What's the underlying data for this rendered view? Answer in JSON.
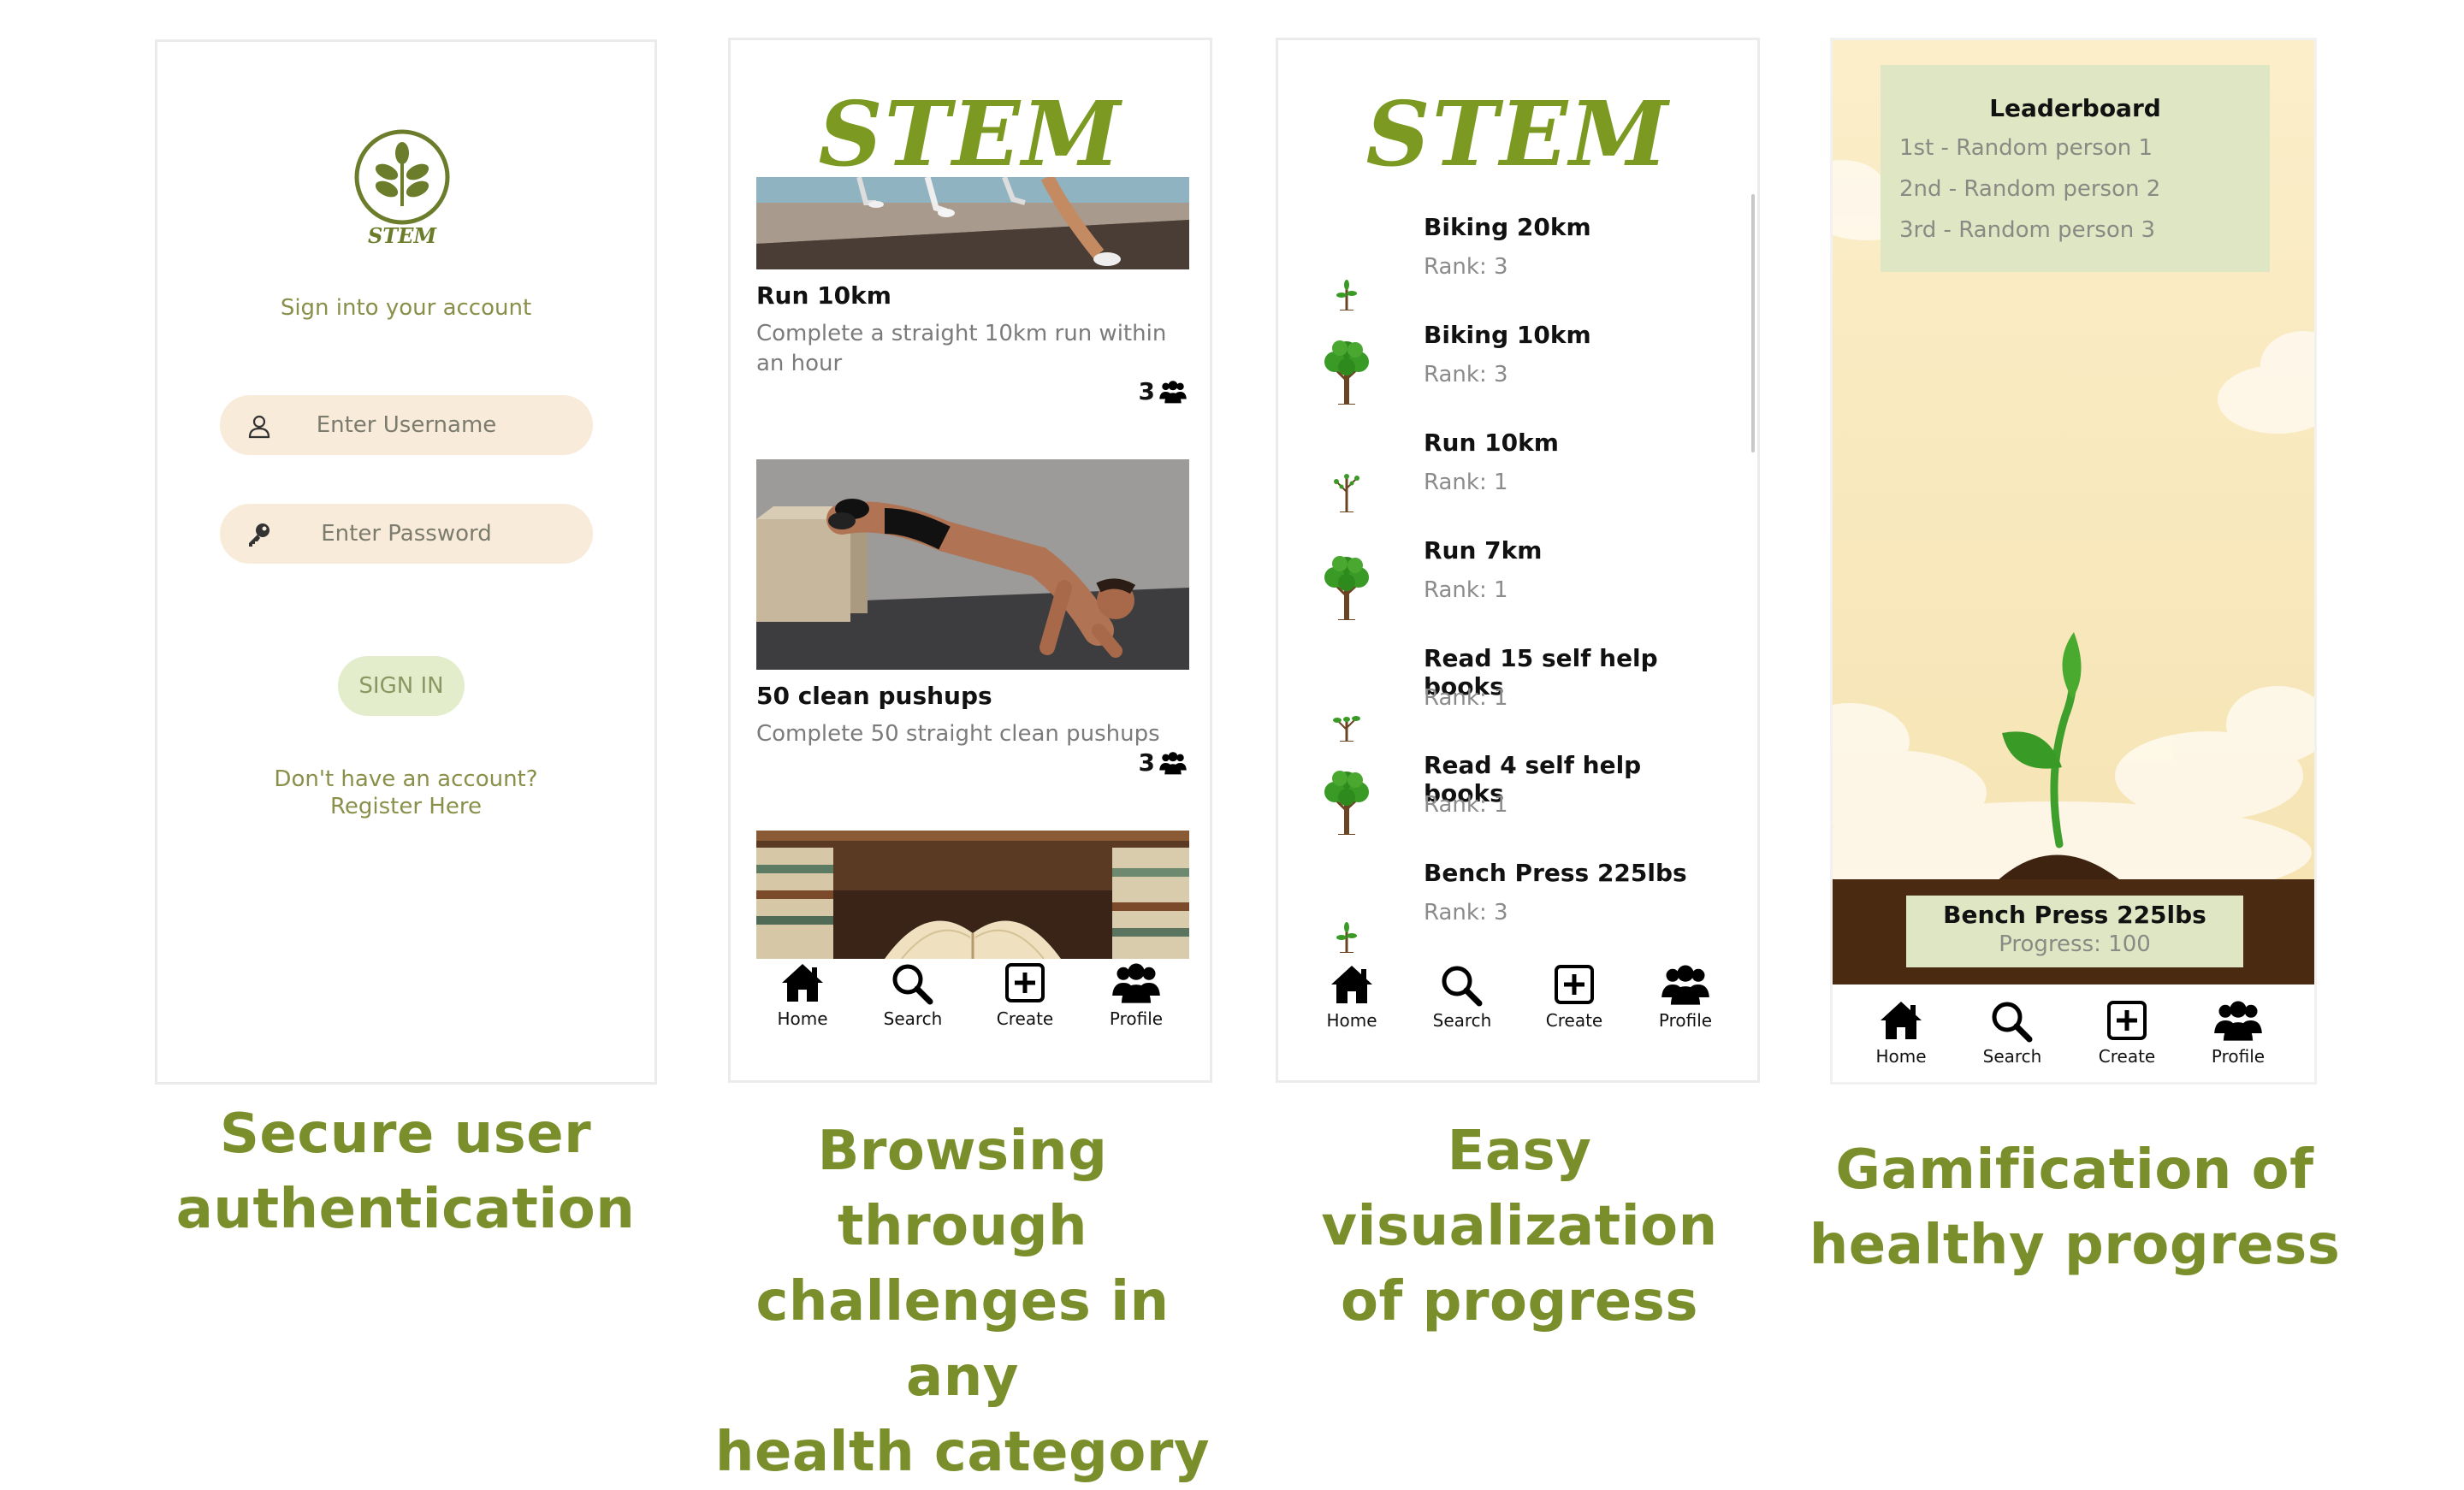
{
  "login": {
    "logo_text": "STEM",
    "signin_prompt": "Sign into your account",
    "username_placeholder": "Enter Username",
    "password_placeholder": "Enter Password",
    "signin_button": "SIGN IN",
    "register_line1": "Don't have an account?",
    "register_line2": "Register Here"
  },
  "browse": {
    "title": "STEM",
    "challenges": [
      {
        "title": "Run 10km",
        "description": "Complete a straight 10km run within an hour",
        "count": "3"
      },
      {
        "title": "50 clean pushups",
        "description": "Complete 50 straight clean pushups",
        "count": "3"
      }
    ]
  },
  "progress": {
    "title": "STEM",
    "items": [
      {
        "title": "Biking 20km",
        "rank": "Rank: 3",
        "tree_icon": "sapling-icon"
      },
      {
        "title": "Biking 10km",
        "rank": "Rank: 3",
        "tree_icon": "full-tree-icon"
      },
      {
        "title": "Run 10km",
        "rank": "Rank: 1",
        "tree_icon": "bare-tree-icon"
      },
      {
        "title": "Run 7km",
        "rank": "Rank: 1",
        "tree_icon": "full-tree-icon"
      },
      {
        "title": "Read 15 self help books",
        "rank": "Rank: 1",
        "tree_icon": "young-tree-icon"
      },
      {
        "title": "Read 4 self help books",
        "rank": "Rank: 1",
        "tree_icon": "full-tree-icon"
      },
      {
        "title": "Bench Press 225lbs",
        "rank": "Rank: 3",
        "tree_icon": "sapling-icon"
      }
    ]
  },
  "game": {
    "leaderboard_title": "Leaderboard",
    "leaderboard": [
      "1st - Random person 1",
      "2nd - Random person 2",
      "3rd - Random person 3"
    ],
    "goal_title": "Bench Press 225lbs",
    "goal_progress": "Progress: 100"
  },
  "nav": {
    "home": "Home",
    "search": "Search",
    "create": "Create",
    "profile": "Profile"
  },
  "captions": {
    "c1_line1": "Secure user",
    "c1_line2": "authentication",
    "c2_line1": "Browsing through",
    "c2_line2": "challenges in any",
    "c2_line3": "health category",
    "c3_line1": "Easy visualization",
    "c3_line2": "of progress",
    "c4_line1": "Gamification of",
    "c4_line2": "healthy progress"
  },
  "colors": {
    "brand_green": "#7c9a22",
    "caption_green": "#7a8f2c",
    "field_bg": "#f8ebda",
    "button_bg": "#e3edcc",
    "panel_bg": "#dfe6c4",
    "soil": "#4a2a10"
  }
}
